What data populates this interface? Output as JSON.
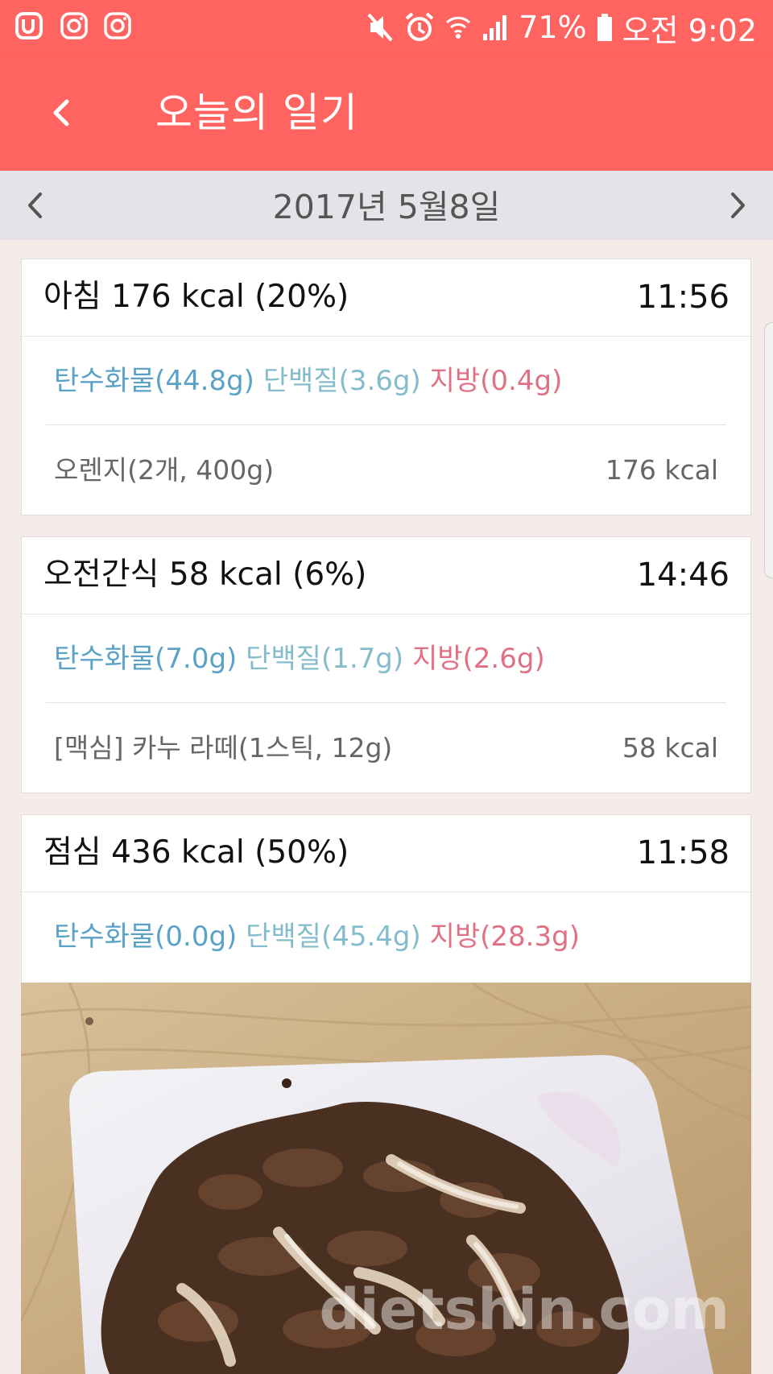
{
  "status_bar": {
    "icons_left": [
      "u-plus-icon",
      "instagram-icon",
      "instagram-icon"
    ],
    "icons_right": [
      "mute-icon",
      "alarm-icon",
      "wifi-icon",
      "signal-icon",
      "battery-icon"
    ],
    "battery": "71%",
    "clock": "오전 9:02"
  },
  "app_bar": {
    "back_icon": "chevron-left-icon",
    "title": "오늘의 일기"
  },
  "date_nav": {
    "date": "2017년 5월8일",
    "prev_icon": "chevron-left-icon",
    "next_icon": "chevron-right-icon"
  },
  "colors": {
    "accent": "#ff6461",
    "carb": "#5aa2c6",
    "protein": "#84bccc",
    "fat": "#e07184"
  },
  "meals": [
    {
      "title": "아침 176 kcal (20%)",
      "time": "11:56",
      "carb": "탄수화물(44.8g)",
      "protein": "단백질(3.6g)",
      "fat": "지방(0.4g)",
      "food_name": "오렌지(2개, 400g)",
      "food_kcal": "176 kcal"
    },
    {
      "title": "오전간식 58 kcal (6%)",
      "time": "14:46",
      "carb": "탄수화물(7.0g)",
      "protein": "단백질(1.7g)",
      "fat": "지방(2.6g)",
      "food_name": "[맥심] 카누 라떼(1스틱, 12g)",
      "food_kcal": "58 kcal"
    },
    {
      "title": "점심 436 kcal (50%)",
      "time": "11:58",
      "carb": "탄수화물(0.0g)",
      "protein": "단백질(45.4g)",
      "fat": "지방(28.3g)"
    }
  ],
  "photo": {
    "watermark": "dietshin.com"
  }
}
